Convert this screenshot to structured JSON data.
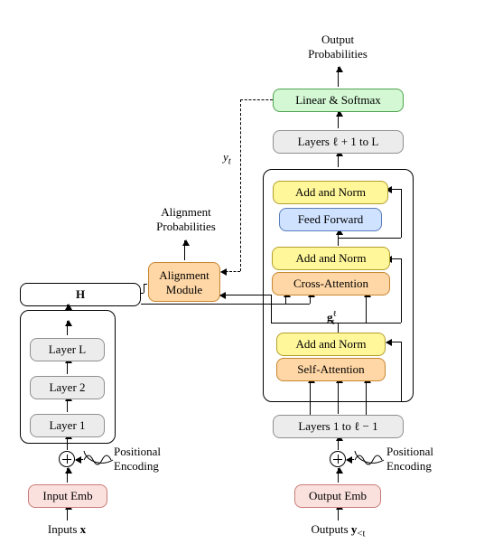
{
  "title_top": "Output",
  "title_bottom": "Probabilities",
  "encoder": {
    "input_emb": "Input Emb",
    "layer1": "Layer 1",
    "layer2": "Layer 2",
    "layerL": "Layer L",
    "pos_enc_top": "Positional",
    "pos_enc_bottom": "Encoding",
    "bottom_label_left": "Inputs ",
    "bottom_label_right": "x",
    "H": "H"
  },
  "alignment": {
    "title_top": "Alignment",
    "title_bottom": "Probabilities",
    "module_top": "Alignment",
    "module_bottom": "Module",
    "y_t": "y",
    "y_t_sub": "t"
  },
  "decoder": {
    "output_emb": "Output Emb",
    "layers_lo": "Layers 1 to ℓ − 1",
    "self_attn": "Self-Attention",
    "addnorm1": "Add and Norm",
    "cross_attn": "Cross-Attention",
    "addnorm2": "Add and Norm",
    "ff": "Feed Forward",
    "addnorm3": "Add and Norm",
    "layers_hi": "Layers ℓ + 1 to L",
    "linear_softmax": "Linear & Softmax",
    "g_label": "g",
    "g_sub": "t",
    "g_sup": "ℓ",
    "pos_enc_top": "Positional",
    "pos_enc_bottom": "Encoding",
    "bottom_label_left": "Outputs ",
    "bottom_label_right": "y",
    "bottom_label_sub": "<t"
  },
  "colors": {
    "gray": "#ececec",
    "pink": "#fbe1de",
    "orange": "#ffd6a5",
    "yellow": "#fff79a",
    "blue": "#cfe2ff",
    "green": "#d3f8d3"
  },
  "chart_data": {
    "type": "diagram",
    "description": "Transformer encoder-decoder with an Alignment Module fed by encoder outputs H and decoder hidden state g^l_t; produces alignment probabilities and also feeds decoder output y_t back.",
    "encoder_layers": [
      "Layer 1",
      "Layer 2",
      "Layer L"
    ],
    "decoder_blocks_below": "Layers 1 to l-1",
    "decoder_block_shown": [
      "Self-Attention",
      "Add and Norm",
      "Cross-Attention",
      "Add and Norm",
      "Feed Forward",
      "Add and Norm"
    ],
    "decoder_blocks_above": "Layers l+1 to L",
    "head": "Linear & Softmax",
    "outputs": "Output Probabilities",
    "side_output": "Alignment Probabilities"
  }
}
